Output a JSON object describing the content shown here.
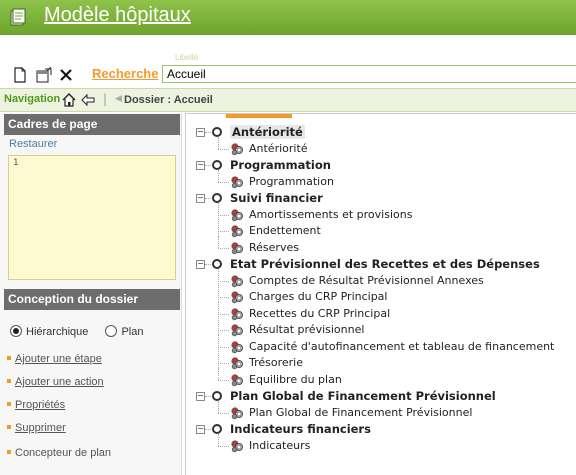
{
  "app": {
    "title": "Modèle hôpitaux"
  },
  "toolbar": {
    "new_icon": "new-document-icon",
    "properties_icon": "properties-icon",
    "delete_icon": "close-icon",
    "search_label": "Recherche",
    "field_label": "Libellé",
    "search_value": "Accueil"
  },
  "navbar": {
    "label": "Navigation",
    "breadcrumb": "Dossier : Accueil"
  },
  "sidebar": {
    "frames_title": "Cadres de page",
    "restore": "Restaurer",
    "frames_list": [
      "1"
    ],
    "design_title": "Conception du dossier",
    "view_hierarchical": "Hiérarchique",
    "view_plan": "Plan",
    "selected_view": "Hiérarchique",
    "actions": [
      "Ajouter une étape",
      "Ajouter une action",
      "Propriétés",
      "Supprimer"
    ],
    "designer": "Concepteur de plan"
  },
  "tree": [
    {
      "label": "Antériorité",
      "selected": true,
      "children": [
        "Antériorité"
      ]
    },
    {
      "label": "Programmation",
      "children": [
        "Programmation"
      ]
    },
    {
      "label": "Suivi financier",
      "children": [
        "Amortissements et provisions",
        "Endettement",
        "Réserves"
      ]
    },
    {
      "label": "Etat Prévisionnel des Recettes et des Dépenses",
      "children": [
        "Comptes de Résultat Prévisionnel Annexes",
        "Charges du CRP Principal",
        "Recettes du CRP Principal",
        "Résultat prévisionnel",
        "Capacité d'autofinancement et tableau de financement",
        "Trésorerie",
        "Equilibre du plan"
      ]
    },
    {
      "label": "Plan Global de Financement Prévisionnel",
      "children": [
        "Plan Global de Financement Prévisionnel"
      ]
    },
    {
      "label": "Indicateurs financiers",
      "children": [
        "Indicateurs"
      ]
    }
  ],
  "colors": {
    "accent_green": "#7fb43c",
    "accent_orange": "#f39a2a",
    "panel_header": "#6d6d6d"
  }
}
